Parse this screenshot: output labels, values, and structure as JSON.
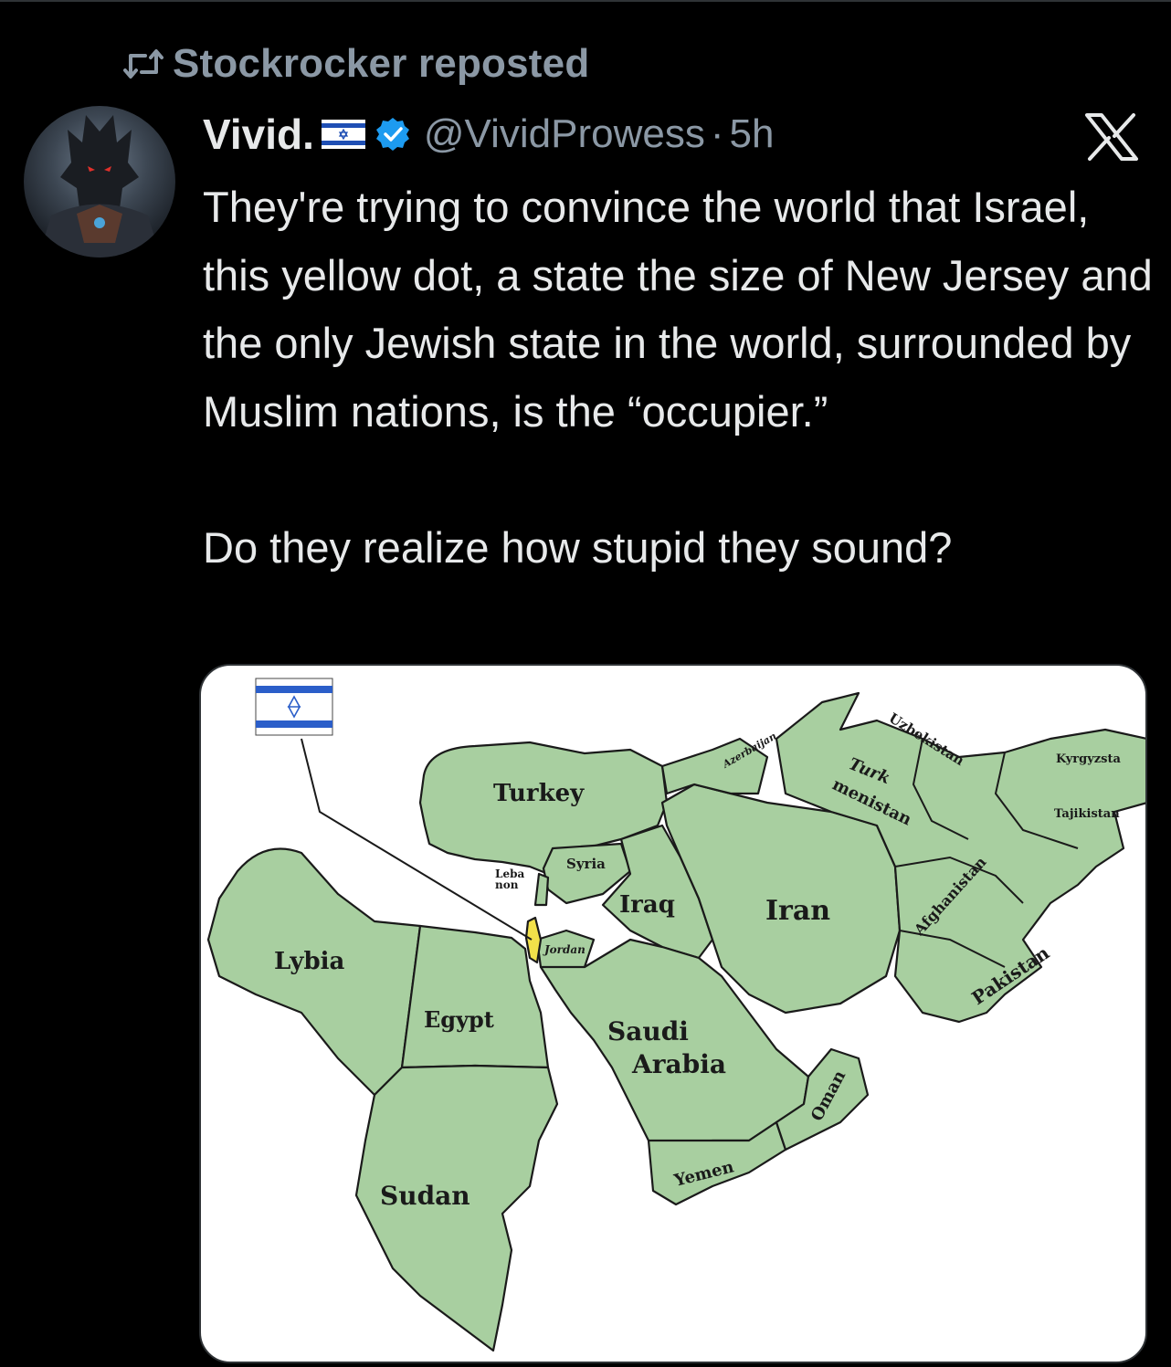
{
  "repost": {
    "text": "Stockrocker reposted"
  },
  "author": {
    "name": "Vivid.",
    "handle": "@VividProwess",
    "separator": "·",
    "time": "5h"
  },
  "tweet": {
    "text": "They're trying to convince the world that Israel, this yellow dot, a state the size of New Jersey and the only Jewish state in the world, surrounded by Muslim nations, is the “occupier.”\n\nDo they realize how stupid they sound?"
  },
  "map": {
    "land_color": "#a8cfa0",
    "israel_color": "#f2e14a",
    "labels": {
      "turkey": "Turkey",
      "syria": "Syria",
      "lebanon_1": "Leba",
      "lebanon_2": "non",
      "iraq": "Iraq",
      "iran": "Iran",
      "lybia": "Lybia",
      "jordan": "Jordan",
      "egypt": "Egypt",
      "saudi_1": "Saudi",
      "saudi_2": "Arabia",
      "sudan": "Sudan",
      "yemen": "Yemen",
      "oman": "Oman",
      "azerbaijan": "Azerbaijan",
      "uzbekistan": "Uzbekistan",
      "turkmenistan_1": "Turk",
      "turkmenistan_2": "menistan",
      "afghanistan": "Afghanistan",
      "pakistan": "Pakistan",
      "kyrgyzstan": "Kyrgyzsta",
      "tajikistan": "Tajikistan"
    }
  },
  "icons": {
    "repost": "repost-icon",
    "verified": "verified-badge-icon",
    "platform": "x-logo-icon",
    "flag": "israel-flag-icon"
  },
  "colors": {
    "verified": "#1d9bf0",
    "secondary_text": "#8b98a5"
  }
}
